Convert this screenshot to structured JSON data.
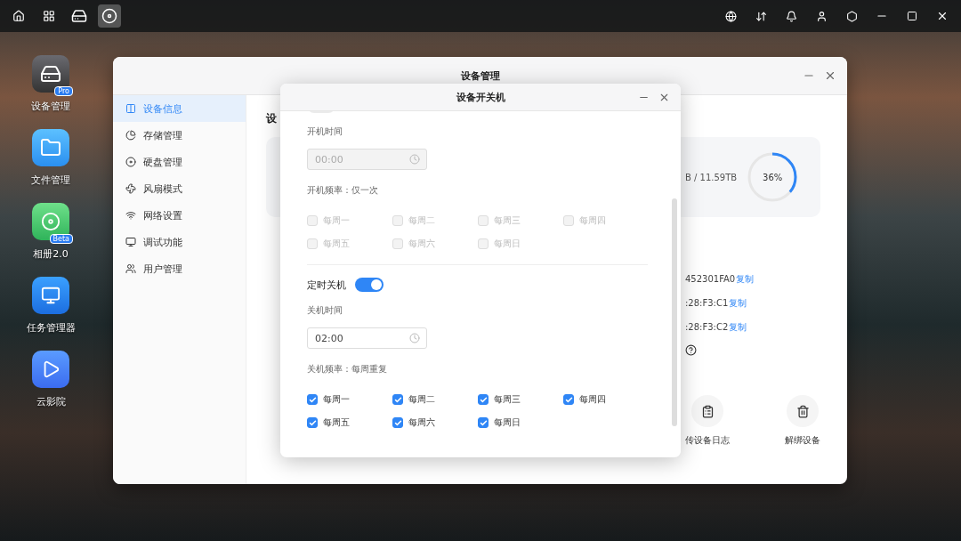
{
  "taskbar": {
    "apps": [
      {
        "kind": "nas",
        "selected": false
      },
      {
        "kind": "power",
        "selected": true
      }
    ]
  },
  "desktop_icons": [
    {
      "kind": "nas",
      "label": "设备管理",
      "badge": "Pro"
    },
    {
      "kind": "files",
      "label": "文件管理"
    },
    {
      "kind": "photos",
      "label": "相册2.0",
      "badge": "Beta"
    },
    {
      "kind": "tasks",
      "label": "任务管理器"
    },
    {
      "kind": "video",
      "label": "云影院"
    }
  ],
  "main_window": {
    "title": "设备管理",
    "sidebar": [
      {
        "kind": "info",
        "label": "设备信息",
        "selected": true
      },
      {
        "kind": "storage",
        "label": "存储管理",
        "selected": false
      },
      {
        "kind": "disk",
        "label": "硬盘管理",
        "selected": false
      },
      {
        "kind": "fan",
        "label": "风扇模式",
        "selected": false
      },
      {
        "kind": "network",
        "label": "网络设置",
        "selected": false
      },
      {
        "kind": "debug",
        "label": "调试功能",
        "selected": false
      },
      {
        "kind": "users",
        "label": "用户管理",
        "selected": false
      }
    ],
    "heading": "设",
    "storage": {
      "usage": "B / 11.59TB",
      "percent": "36%",
      "level": 0.36
    },
    "info_rows": [
      {
        "value": "452301FA0",
        "action": "复制"
      },
      {
        "value": ":28:F3:C1",
        "action": "复制"
      },
      {
        "value": ":28:F3:C2",
        "action": "复制"
      }
    ],
    "actions": [
      {
        "kind": "log",
        "label": "传设备日志"
      },
      {
        "kind": "unbind",
        "label": "解绑设备"
      }
    ]
  },
  "dialog": {
    "title": "设备开关机",
    "startup": {
      "on": false,
      "disabled": true,
      "time_label": "开机时间",
      "time": "00:00",
      "frequency": "开机频率：仅一次",
      "days": [
        {
          "label": "每周一",
          "checked": false
        },
        {
          "label": "每周二",
          "checked": false
        },
        {
          "label": "每周三",
          "checked": false
        },
        {
          "label": "每周四",
          "checked": false
        },
        {
          "label": "每周五",
          "checked": false
        },
        {
          "label": "每周六",
          "checked": false
        },
        {
          "label": "每周日",
          "checked": false
        }
      ]
    },
    "shutdown": {
      "title": "定时关机",
      "on": true,
      "disabled": false,
      "time_label": "关机时间",
      "time": "02:00",
      "frequency": "关机频率：每周重复",
      "days": [
        {
          "label": "每周一",
          "checked": true
        },
        {
          "label": "每周二",
          "checked": true
        },
        {
          "label": "每周三",
          "checked": true
        },
        {
          "label": "每周四",
          "checked": true
        },
        {
          "label": "每周五",
          "checked": true
        },
        {
          "label": "每周六",
          "checked": true
        },
        {
          "label": "每周日",
          "checked": true
        }
      ]
    }
  }
}
